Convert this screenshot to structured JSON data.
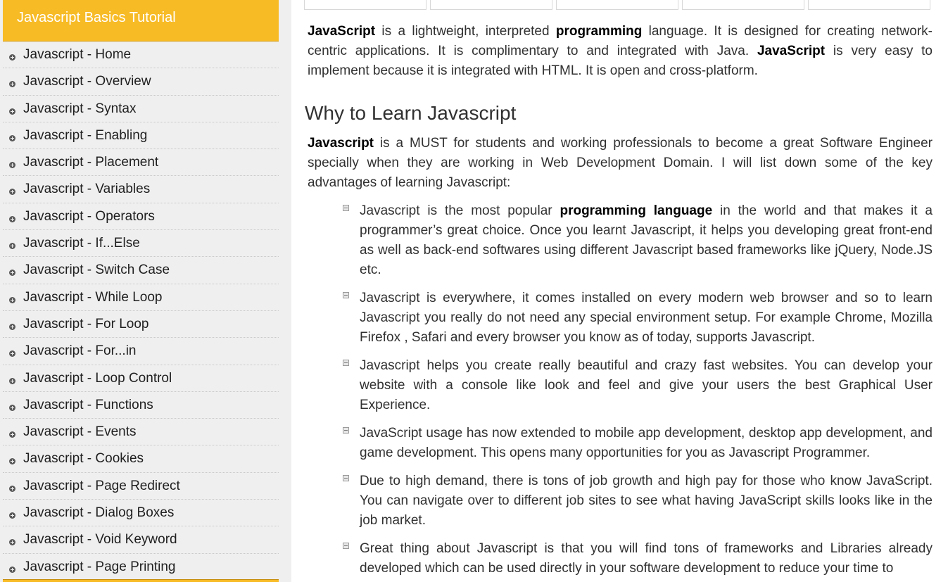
{
  "sidebar": {
    "title": "Javascript Basics Tutorial",
    "items": [
      "Javascript - Home",
      "Javascript - Overview",
      "Javascript - Syntax",
      "Javascript - Enabling",
      "Javascript - Placement",
      "Javascript - Variables",
      "Javascript - Operators",
      "Javascript - If...Else",
      "Javascript - Switch Case",
      "Javascript - While Loop",
      "Javascript - For Loop",
      "Javascript - For...in",
      "Javascript - Loop Control",
      "Javascript - Functions",
      "Javascript - Events",
      "Javascript - Cookies",
      "Javascript - Page Redirect",
      "Javascript - Dialog Boxes",
      "Javascript - Void Keyword",
      "Javascript - Page Printing"
    ]
  },
  "intro": {
    "b1": "JavaScript",
    "t1": " is a lightweight, interpreted ",
    "b2": "programming",
    "t2": " language. It is designed for creating network-centric applications. It is complimentary to and integrated with Java. ",
    "b3": "JavaScript",
    "t3": " is very easy to implement because it is integrated with HTML. It is open and cross-platform."
  },
  "why": {
    "heading": "Why to Learn Javascript",
    "b1": "Javascript",
    "t1": " is a MUST for students and working professionals to become a great Software Engineer specially when they are working in Web Development Domain. I will list down some of the key advantages of learning Javascript:"
  },
  "advantages": {
    "a1_pre": "Javascript is the most popular ",
    "a1_bold": "programming language",
    "a1_post": " in the world and that makes it a programmer’s great choice. Once you learnt Javascript, it helps you developing great front-end as well as back-end softwares using different Javascript based frameworks like jQuery, Node.JS etc.",
    "a2": "Javascript is everywhere, it comes installed on every modern web browser and so to learn Javascript you really do not need any special environment setup. For example Chrome, Mozilla Firefox , Safari and every browser you know as of today, supports Javascript.",
    "a3": "Javascript helps you create really beautiful and crazy fast websites. You can develop your website with a console like look and feel and give your users the best Graphical User Experience.",
    "a4": "JavaScript usage has now extended to mobile app development, desktop app development, and game development. This opens many opportunities for you as Javascript Programmer.",
    "a5": "Due to high demand, there is tons of job growth and high pay for those who know JavaScript. You can navigate over to different job sites to see what having JavaScript skills looks like in the job market.",
    "a6": "Great thing about Javascript is that you will find tons of frameworks and Libraries already developed which can be used directly in your software development to reduce your time to"
  },
  "colors": {
    "header_accent": "#f7bb26",
    "sidebar_bg": "#efefef"
  }
}
